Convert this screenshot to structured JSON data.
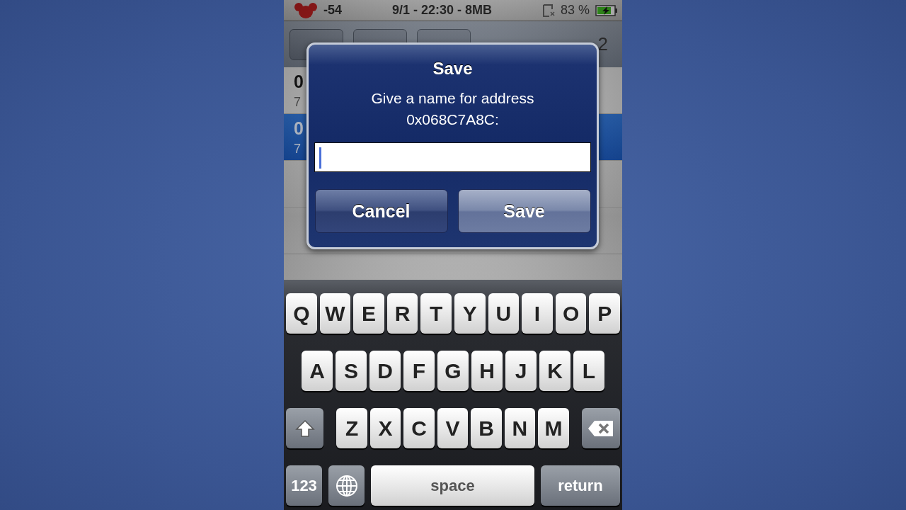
{
  "status_bar": {
    "signal": "-54",
    "center": "9/1 - 22:30 - 8MB",
    "battery": "83 %",
    "charging": true
  },
  "toolbar": {
    "found": "2"
  },
  "results": [
    {
      "address": "0",
      "value": "7",
      "selected": false
    },
    {
      "address": "0",
      "value": "7",
      "selected": true
    }
  ],
  "dialog": {
    "title": "Save",
    "message": "Give a name for address",
    "address": "0x068C7A8C:",
    "buttons": [
      {
        "label": "Cancel",
        "primary": false
      },
      {
        "label": "Save",
        "primary": true
      }
    ]
  },
  "keyboard": {
    "rows": [
      {
        "keys": [
          {
            "kind": "letter",
            "label": "Q"
          },
          {
            "kind": "letter",
            "label": "W"
          },
          {
            "kind": "letter",
            "label": "E"
          },
          {
            "kind": "letter",
            "label": "R"
          },
          {
            "kind": "letter",
            "label": "T"
          },
          {
            "kind": "letter",
            "label": "Y"
          },
          {
            "kind": "letter",
            "label": "U"
          },
          {
            "kind": "letter",
            "label": "I"
          },
          {
            "kind": "letter",
            "label": "O"
          },
          {
            "kind": "letter",
            "label": "P"
          }
        ]
      },
      {
        "keys": [
          {
            "kind": "letter",
            "label": "A"
          },
          {
            "kind": "letter",
            "label": "S"
          },
          {
            "kind": "letter",
            "label": "D"
          },
          {
            "kind": "letter",
            "label": "F"
          },
          {
            "kind": "letter",
            "label": "G"
          },
          {
            "kind": "letter",
            "label": "H"
          },
          {
            "kind": "letter",
            "label": "J"
          },
          {
            "kind": "letter",
            "label": "K"
          },
          {
            "kind": "letter",
            "label": "L"
          }
        ]
      },
      {
        "keys": [
          {
            "kind": "shift"
          },
          {
            "kind": "letter",
            "label": "Z"
          },
          {
            "kind": "letter",
            "label": "X"
          },
          {
            "kind": "letter",
            "label": "C"
          },
          {
            "kind": "letter",
            "label": "V"
          },
          {
            "kind": "letter",
            "label": "B"
          },
          {
            "kind": "letter",
            "label": "N"
          },
          {
            "kind": "letter",
            "label": "M"
          },
          {
            "kind": "delete"
          }
        ]
      },
      {
        "keys": [
          {
            "kind": "mode",
            "label": "123"
          },
          {
            "kind": "globe"
          },
          {
            "kind": "space",
            "label": "space"
          },
          {
            "kind": "return",
            "label": "return"
          }
        ]
      }
    ]
  }
}
